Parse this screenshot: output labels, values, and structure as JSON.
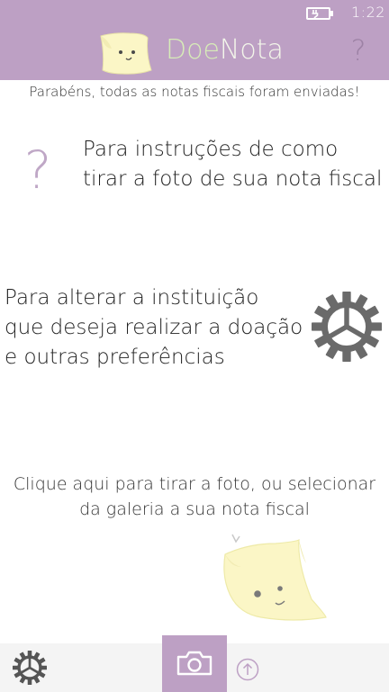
{
  "status_bar": {
    "time": "1:22",
    "battery_icon": "battery-charging-icon"
  },
  "header": {
    "title_part1": "Doe",
    "title_part2": "Nota",
    "help_label": "?",
    "background_color": "#bda0c4",
    "title_color_1": "#d7ecb8",
    "title_color_2": "#f3f6ea"
  },
  "status_message": "Parabéns, todas as notas fiscais foram enviadas!",
  "instructions": {
    "icon_label": "?",
    "text": "Para instruções de como\ntirar a foto de sua nota fiscal"
  },
  "preferences": {
    "text": "Para alterar a instituição\nque deseja realizar a doação\ne outras preferências",
    "icon": "gear-icon"
  },
  "camera_hint": {
    "text": "Clique aqui para tirar a foto, ou selecionar\nda galeria a sua nota fiscal"
  },
  "app_bar": {
    "settings_icon": "gear-icon",
    "camera_icon": "camera-icon",
    "upload_icon": "upload-icon",
    "accent_color": "#bda0c4"
  }
}
